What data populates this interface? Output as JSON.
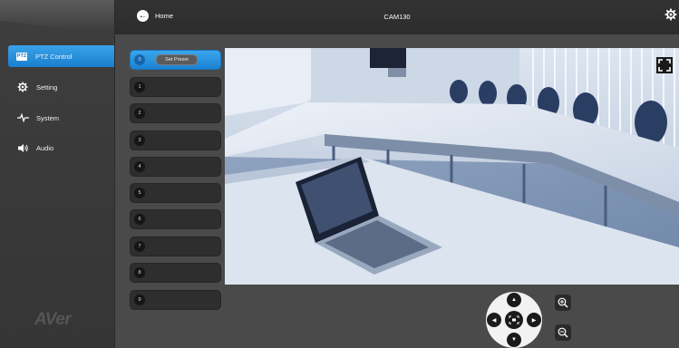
{
  "header": {
    "home_label": "Home",
    "device_name": "CAM130"
  },
  "sidebar": {
    "items": [
      {
        "label": "PTZ Control",
        "badge": "PTZ",
        "icon": "ptz-icon"
      },
      {
        "label": "Setting",
        "icon": "gear-icon"
      },
      {
        "label": "System",
        "icon": "pulse-icon"
      },
      {
        "label": "Audio",
        "icon": "speaker-icon"
      }
    ],
    "logo": "AVer"
  },
  "presets": {
    "numbers": [
      "0",
      "1",
      "2",
      "3",
      "4",
      "5",
      "6",
      "7",
      "8",
      "9"
    ],
    "set_preset_label": "Set Preset"
  },
  "colors": {
    "accent": "#1f8ad8",
    "panel": "#2e2e2e",
    "background": "#4a4a4a"
  }
}
